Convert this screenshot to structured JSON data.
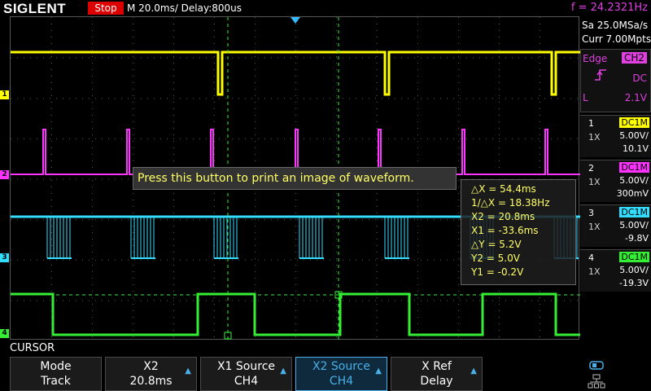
{
  "topbar": {
    "brand": "SIGLENT",
    "run_state": "Stop",
    "timebase": "M 20.0ms/ Delay:800us",
    "frequency": "f = 24.2321Hz"
  },
  "acquisition": {
    "sample_rate": "Sa 25.0MSa/s",
    "memory_depth": "Curr 7.00Mpts"
  },
  "trigger": {
    "type": "Edge",
    "source": "CH2",
    "slope_icon": "rising-edge-icon",
    "coupling": "DC",
    "level_label": "L",
    "level": "2.1V"
  },
  "channels": [
    {
      "num": "1",
      "coupling": "DC1M",
      "probe": "1X",
      "scale": "5.00V/",
      "offset": "10.1V",
      "color": "#ffff00"
    },
    {
      "num": "2",
      "coupling": "DC1M",
      "probe": "1X",
      "scale": "5.00V/",
      "offset": "300mV",
      "color": "#ff33ff"
    },
    {
      "num": "3",
      "coupling": "DC1M",
      "probe": "1X",
      "scale": "5.00V/",
      "offset": "-9.8V",
      "color": "#33ddff"
    },
    {
      "num": "4",
      "coupling": "DC1M",
      "probe": "1X",
      "scale": "5.00V/",
      "offset": "-19.3V",
      "color": "#33ee33"
    }
  ],
  "tooltip": "Press this button to print an image of waveform.",
  "cursor_readout": {
    "dx": "△X = 54.4ms",
    "inv_dx": "1/△X = 18.38Hz",
    "x2": "X2 = 20.8ms",
    "x1": "X1 = -33.6ms",
    "dy": "△Y = 5.2V",
    "y2": "Y2 = 5.0V",
    "y1": "Y1 = -0.2V"
  },
  "menu": {
    "title": "CURSOR",
    "keys": [
      {
        "top": "Mode",
        "bottom": "Track"
      },
      {
        "top": "X2",
        "bottom": "20.8ms"
      },
      {
        "top": "X1 Source",
        "bottom": "CH4"
      },
      {
        "top": "X2 Source",
        "bottom": "CH4"
      },
      {
        "top": "X Ref",
        "bottom": "Delay"
      }
    ]
  }
}
